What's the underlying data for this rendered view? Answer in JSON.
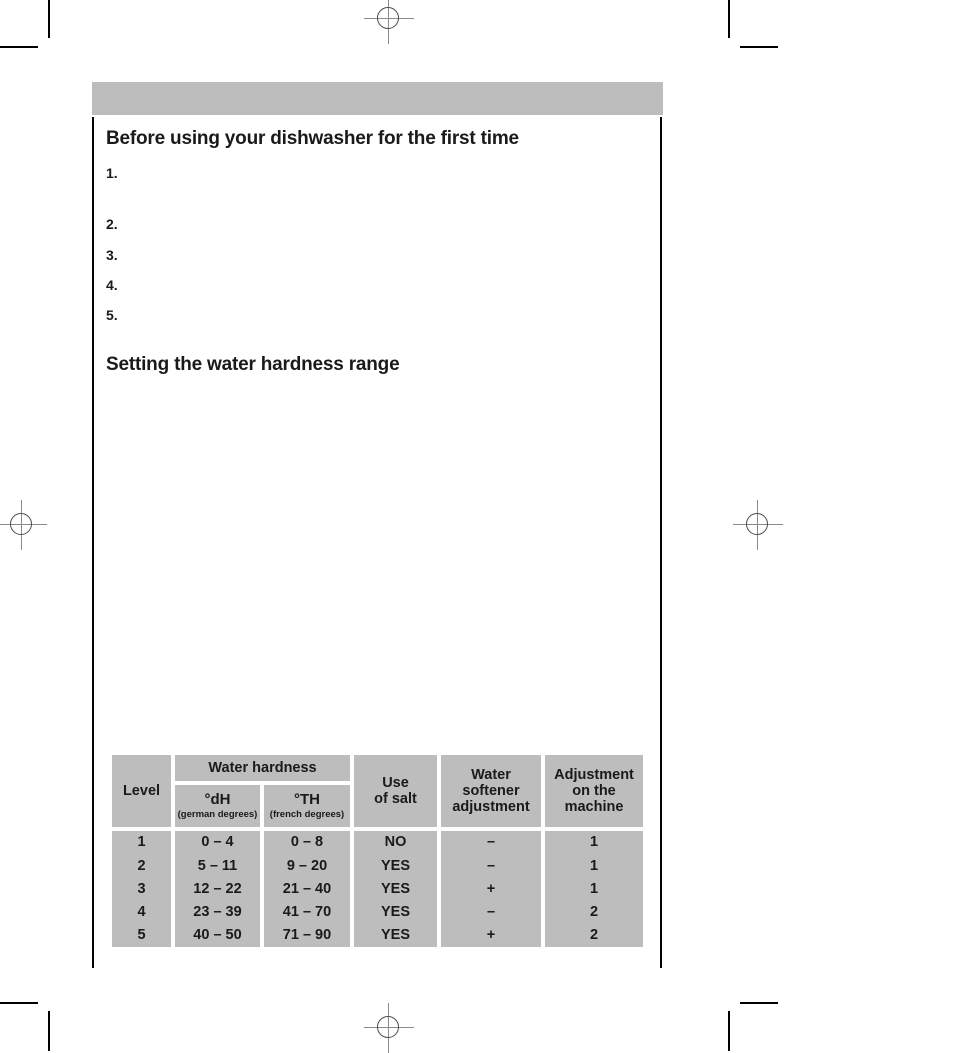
{
  "page": {
    "header_bar_color": "#bdbdbd",
    "table_cell_color": "#bdbdbd",
    "text_color": "#1a1a1a"
  },
  "headings": {
    "before_first_use": "Before using your dishwasher for the first time",
    "water_hardness": "Setting the water hardness range"
  },
  "steps": [
    {
      "marker": "1.",
      "text": ""
    },
    {
      "marker": "2.",
      "text": ""
    },
    {
      "marker": "3.",
      "text": ""
    },
    {
      "marker": "4.",
      "text": ""
    },
    {
      "marker": "5.",
      "text": ""
    }
  ],
  "table": {
    "headers": {
      "level": "Level",
      "water_hardness_group": "Water hardness",
      "dh": "°dH",
      "dh_sub": "(german degrees)",
      "th": "°TH",
      "th_sub": "(french degrees)",
      "use_of_salt_line1": "Use",
      "use_of_salt_line2": "of salt",
      "softener_line1": "Water",
      "softener_line2": "softener",
      "softener_line3": "adjustment",
      "machine_line1": "Adjustment",
      "machine_line2": "on the",
      "machine_line3": "machine"
    },
    "rows": [
      {
        "level": "1",
        "dh": "0 – 4",
        "th": "0 – 8",
        "salt": "NO",
        "softener": "–",
        "machine": "1"
      },
      {
        "level": "2",
        "dh": "5 – 11",
        "th": "9 – 20",
        "salt": "YES",
        "softener": "–",
        "machine": "1"
      },
      {
        "level": "3",
        "dh": "12 – 22",
        "th": "21 – 40",
        "salt": "YES",
        "softener": "+",
        "machine": "1"
      },
      {
        "level": "4",
        "dh": "23 – 39",
        "th": "41 – 70",
        "salt": "YES",
        "softener": "–",
        "machine": "2"
      },
      {
        "level": "5",
        "dh": "40 – 50",
        "th": "71 – 90",
        "salt": "YES",
        "softener": "+",
        "machine": "2"
      }
    ]
  }
}
